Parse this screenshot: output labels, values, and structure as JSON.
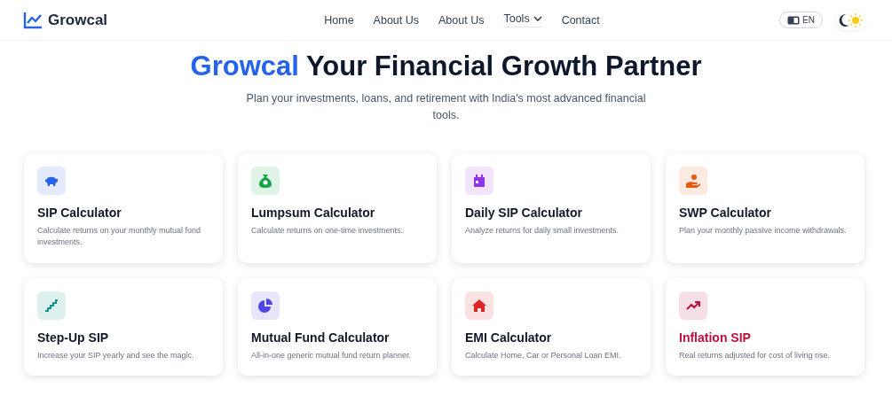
{
  "brand": {
    "name": "Growcal"
  },
  "nav": [
    {
      "label": "Home",
      "kind": "link"
    },
    {
      "label": "About Us",
      "kind": "link"
    },
    {
      "label": "About Us",
      "kind": "link"
    },
    {
      "label": "Tools",
      "kind": "dropdown"
    },
    {
      "label": "Contact",
      "kind": "link"
    }
  ],
  "language": {
    "label": "EN"
  },
  "hero": {
    "brand": "Growcal",
    "title": "Your Financial Growth Partner",
    "subtitle": "Plan your investments, loans, and retirement with India's most advanced financial tools."
  },
  "cards": [
    {
      "kind": "piggy",
      "color": "#2563eb",
      "title": "SIP Calculator",
      "description": "Calculate returns on your monthly mutual fund investments.",
      "highlighted": false
    },
    {
      "kind": "money-bag",
      "color": "#16a34a",
      "title": "Lumpsum Calculator",
      "description": "Calculate returns on one-time investments.",
      "highlighted": false
    },
    {
      "kind": "calendar",
      "color": "#9333ea",
      "title": "Daily SIP Calculator",
      "description": "Analyze returns for daily small investments.",
      "highlighted": false
    },
    {
      "kind": "hand-coin",
      "color": "#ea580c",
      "title": "SWP Calculator",
      "description": "Plan your monthly passive income withdrawals.",
      "highlighted": false
    },
    {
      "kind": "stairs",
      "color": "#0d9488",
      "title": "Step-Up SIP",
      "description": "Increase your SIP yearly and see the magic.",
      "highlighted": false
    },
    {
      "kind": "pie",
      "color": "#4f46e5",
      "title": "Mutual Fund Calculator",
      "description": "All-in-one generic mutual fund return planner.",
      "highlighted": false
    },
    {
      "kind": "house",
      "color": "#dc2626",
      "title": "EMI Calculator",
      "description": "Calculate Home, Car or Personal Loan EMI.",
      "highlighted": false
    },
    {
      "kind": "trend",
      "color": "#be123c",
      "title": "Inflation SIP",
      "description": "Real returns adjusted for cost of living rise.",
      "highlighted": true
    }
  ]
}
